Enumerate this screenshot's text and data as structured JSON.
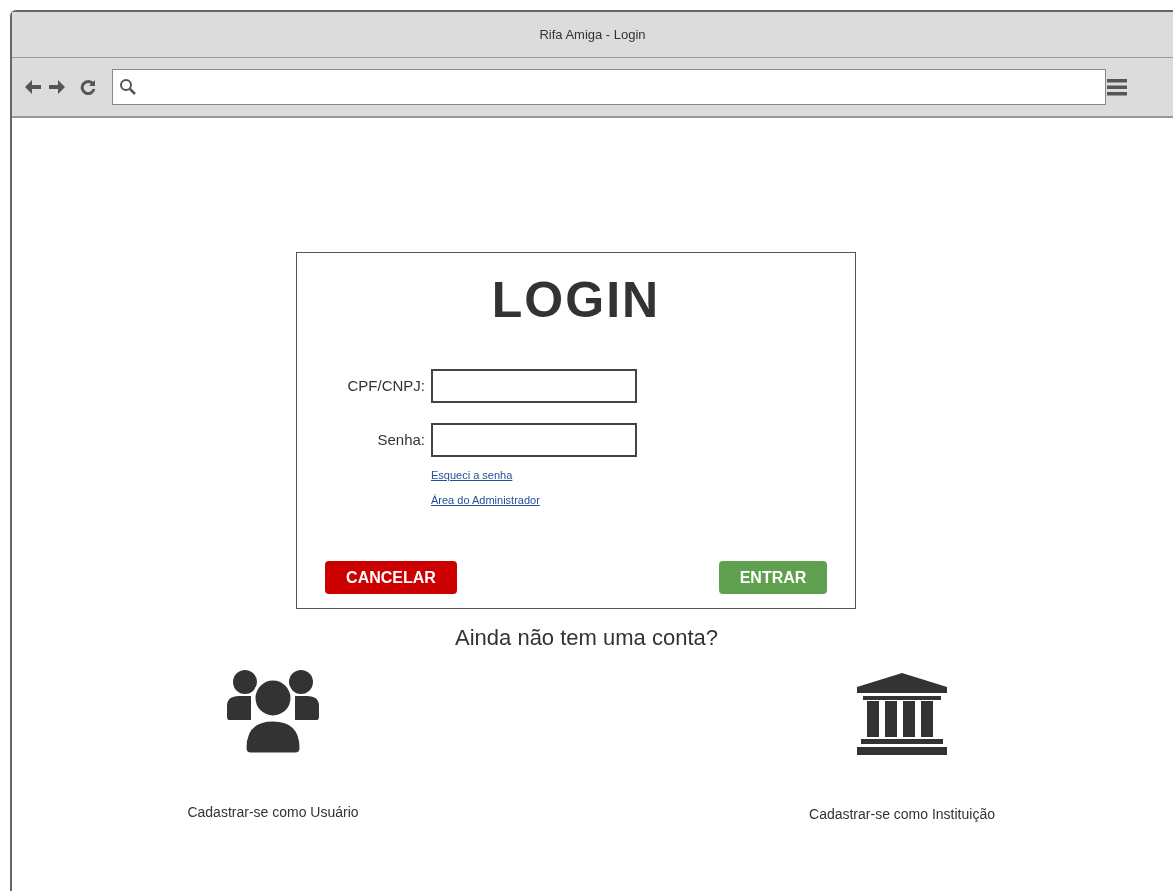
{
  "window": {
    "title": "Rifa Amiga - Login"
  },
  "login": {
    "title": "LOGIN",
    "fields": [
      {
        "label": "CPF/CNPJ:"
      },
      {
        "label": "Senha:"
      }
    ],
    "links": [
      "Esqueci a senha",
      "Área do Administrador"
    ],
    "buttons": [
      {
        "label": "CANCELAR",
        "kind": "cancel"
      },
      {
        "label": "ENTRAR",
        "kind": "submit"
      }
    ]
  },
  "signup": {
    "prompt": "Ainda não tem uma conta?",
    "options": [
      {
        "label": "Cadastrar-se como Usuário",
        "kind": "user"
      },
      {
        "label": "Cadastrar-se como Instituição",
        "kind": "institution"
      }
    ]
  }
}
